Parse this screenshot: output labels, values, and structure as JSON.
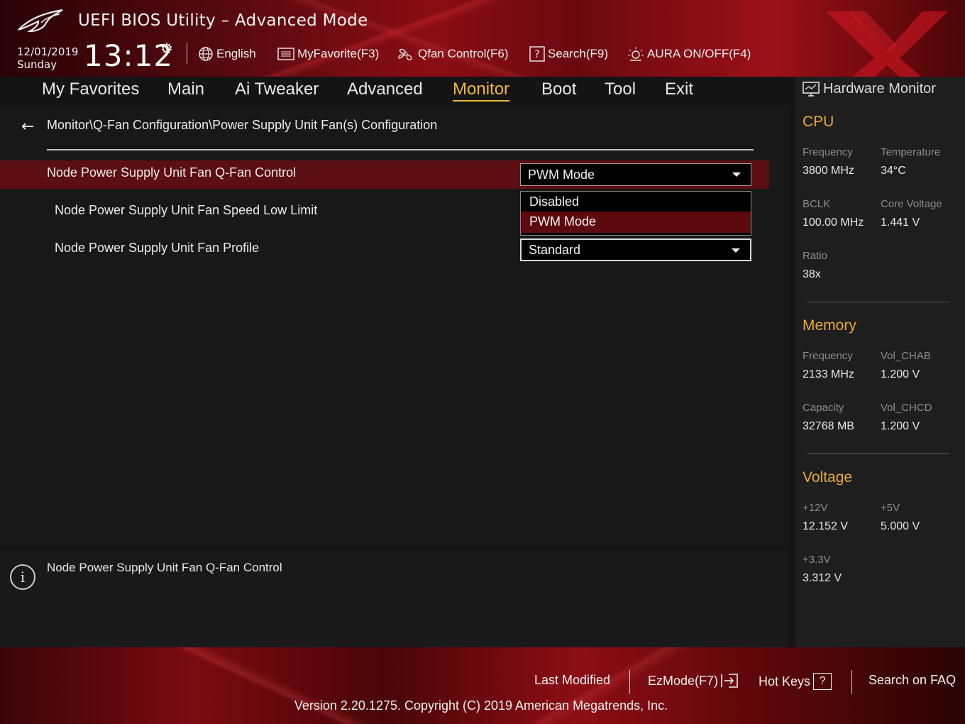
{
  "header": {
    "title": "UEFI BIOS Utility – Advanced Mode",
    "date": "12/01/2019",
    "day": "Sunday",
    "time": "13:12",
    "toolbar": {
      "language": "English",
      "my_favorite": "MyFavorite(F3)",
      "qfan": "Qfan Control(F6)",
      "search": "Search(F9)",
      "aura": "AURA ON/OFF(F4)"
    }
  },
  "nav": {
    "items": [
      "My Favorites",
      "Main",
      "Ai Tweaker",
      "Advanced",
      "Monitor",
      "Boot",
      "Tool",
      "Exit"
    ],
    "active": "Monitor"
  },
  "main": {
    "breadcrumb": "Monitor\\Q-Fan Configuration\\Power Supply Unit Fan(s) Configuration",
    "options": [
      {
        "label": "Node Power Supply Unit Fan Q-Fan Control",
        "value": "PWM Mode"
      },
      {
        "label": "Node Power Supply Unit Fan Speed Low Limit"
      },
      {
        "label": "Node Power Supply Unit Fan Profile",
        "value": "Standard"
      }
    ],
    "dropdown": {
      "items": [
        "Disabled",
        "PWM Mode"
      ],
      "selected": "PWM Mode"
    }
  },
  "info": {
    "text": "Node Power Supply Unit Fan Q-Fan Control"
  },
  "hw_monitor": {
    "title": "Hardware Monitor",
    "cpu": {
      "heading": "CPU",
      "frequency_label": "Frequency",
      "frequency": "3800 MHz",
      "temperature_label": "Temperature",
      "temperature": "34°C",
      "bclk_label": "BCLK",
      "bclk": "100.00 MHz",
      "core_voltage_label": "Core Voltage",
      "core_voltage": "1.441 V",
      "ratio_label": "Ratio",
      "ratio": "38x"
    },
    "memory": {
      "heading": "Memory",
      "frequency_label": "Frequency",
      "frequency": "2133 MHz",
      "vol_chab_label": "Vol_CHAB",
      "vol_chab": "1.200 V",
      "capacity_label": "Capacity",
      "capacity": "32768 MB",
      "vol_chcd_label": "Vol_CHCD",
      "vol_chcd": "1.200 V"
    },
    "voltage": {
      "heading": "Voltage",
      "v12_label": "+12V",
      "v12": "12.152 V",
      "v5_label": "+5V",
      "v5": "5.000 V",
      "v33_label": "+3.3V",
      "v33": "3.312 V"
    }
  },
  "footer": {
    "last_modified": "Last Modified",
    "ezmode": "EzMode(F7)",
    "hot_keys": "Hot Keys",
    "hot_keys_key": "?",
    "search_faq": "Search on FAQ",
    "version": "Version 2.20.1275. Copyright (C) 2019 American Megatrends, Inc."
  },
  "colors": {
    "accent": "#f0b83c",
    "highlight": "#5c0e12",
    "section": "#e9a93a"
  }
}
